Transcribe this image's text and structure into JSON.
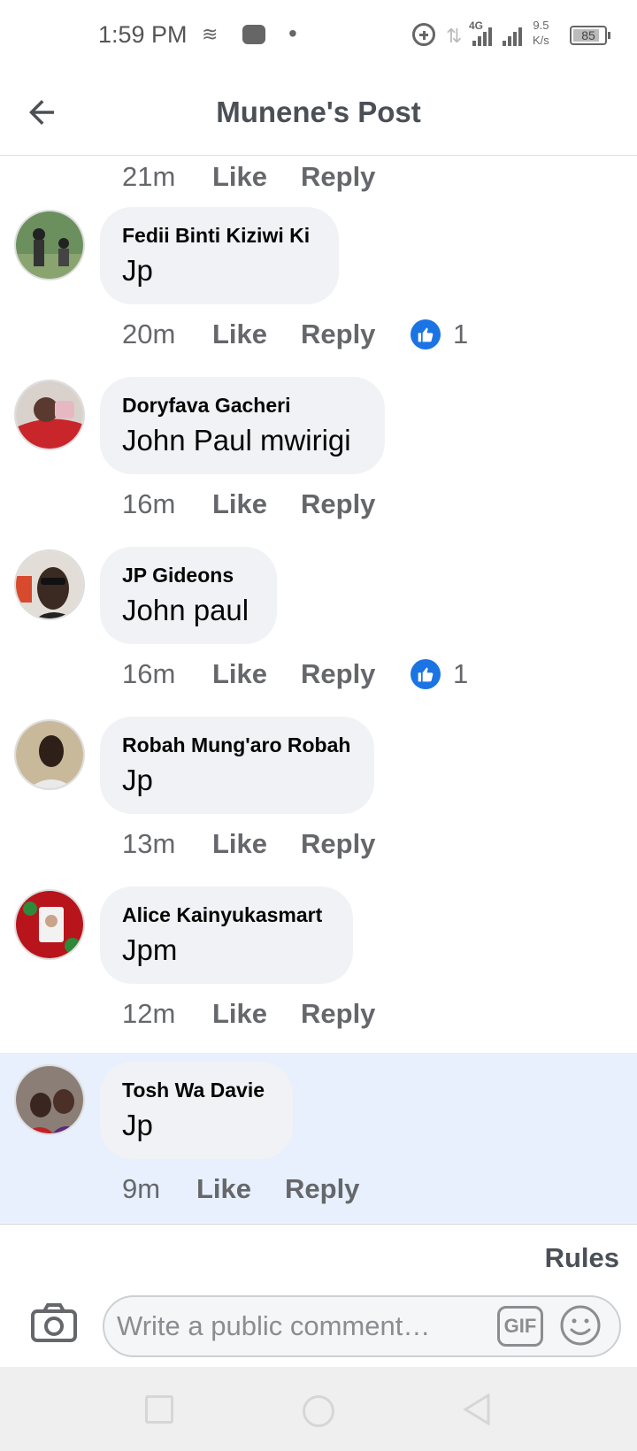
{
  "status_bar": {
    "time": "1:59 PM",
    "network_type": "4G",
    "speed_value": "9.5",
    "speed_unit": "K/s",
    "battery": "85",
    "icons": [
      "weather-icon",
      "game-icon",
      "dot-icon",
      "add-circle-icon",
      "data-arrows-icon",
      "signal-icon",
      "battery-icon"
    ]
  },
  "header": {
    "title": "Munene's Post",
    "back_icon": "back-arrow-icon"
  },
  "first_meta": {
    "time": "21m",
    "like_label": "Like",
    "reply_label": "Reply"
  },
  "comments": [
    {
      "author": "Fedii Binti Kiziwi Ki",
      "text": "Jp",
      "time": "20m",
      "like_label": "Like",
      "reply_label": "Reply",
      "reactions": "1",
      "highlighted": false
    },
    {
      "author": "Doryfava Gacheri",
      "text": "John Paul mwirigi",
      "time": "16m",
      "like_label": "Like",
      "reply_label": "Reply",
      "reactions": null,
      "highlighted": false
    },
    {
      "author": "JP Gideons",
      "text": "John paul",
      "time": "16m",
      "like_label": "Like",
      "reply_label": "Reply",
      "reactions": "1",
      "highlighted": false
    },
    {
      "author": "Robah Mung'aro Robah",
      "text": "Jp",
      "time": "13m",
      "like_label": "Like",
      "reply_label": "Reply",
      "reactions": null,
      "highlighted": false
    },
    {
      "author": "Alice Kainyukasmart",
      "text": "Jpm",
      "time": "12m",
      "like_label": "Like",
      "reply_label": "Reply",
      "reactions": null,
      "highlighted": false
    },
    {
      "author": "Tosh Wa Davie",
      "text": "Jp",
      "time": "9m",
      "like_label": "Like",
      "reply_label": "Reply",
      "reactions": null,
      "highlighted": true
    }
  ],
  "composer": {
    "rules_label": "Rules",
    "placeholder": "Write a public comment…",
    "gif_label": "GIF",
    "camera_icon": "camera-icon",
    "emoji_icon": "emoji-icon"
  },
  "colors": {
    "accent": "#1b74e4",
    "highlight_bg": "#e7f0fc",
    "bubble_bg": "#f0f2f5",
    "meta_text": "#65676b"
  }
}
